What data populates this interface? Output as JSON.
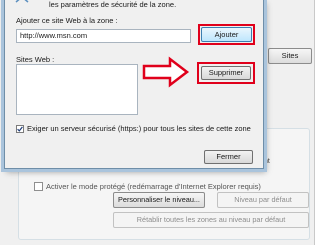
{
  "background": {
    "sites_button_label": "Sites",
    "group_partial_text": "nt",
    "protected_mode_label": "Activer le mode protégé (redémarrage d'Internet Explorer requis)",
    "custom_level_label": "Personnaliser le niveau...",
    "default_level_label": "Niveau par défaut",
    "reset_all_label": "Rétablir toutes les zones au niveau par défaut"
  },
  "dialog": {
    "top_text": "les paramètres de sécurité de la zone.",
    "add_label": "Ajouter ce site Web à la zone :",
    "add_input_value": "http://www.msn.com",
    "add_button_label": "Ajouter",
    "websites_label": "Sites Web :",
    "remove_button_label": "Supprimer",
    "https_checkbox_label": "Exiger un serveur sécurisé (https:) pour tous les sites de cette zone",
    "https_checked": true,
    "close_button_label": "Fermer"
  },
  "colors": {
    "highlight": "#e0001b",
    "dialog_border": "#6f8ea8"
  }
}
